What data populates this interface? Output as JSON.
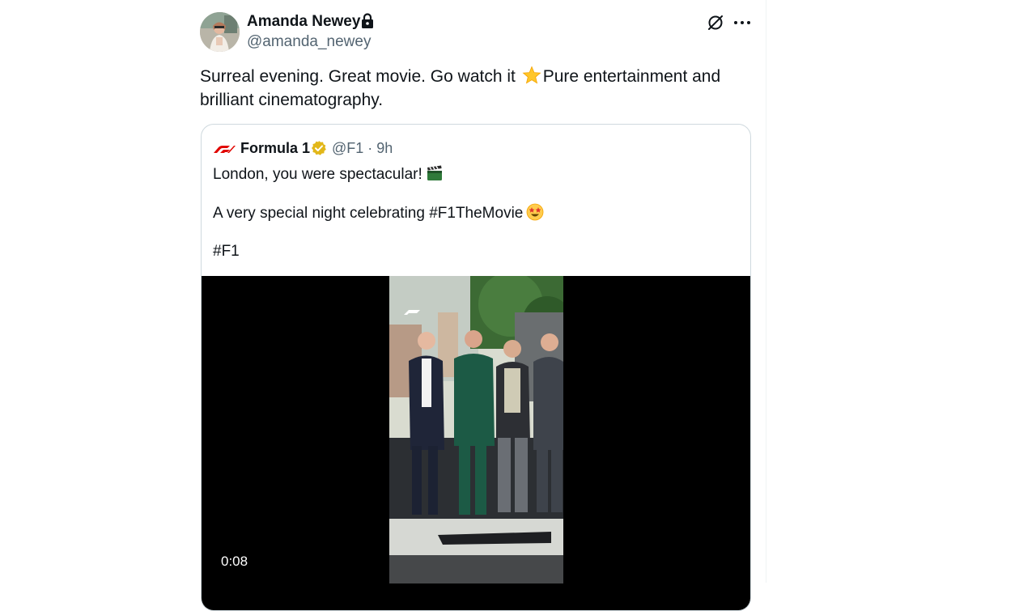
{
  "author": {
    "display_name": "Amanda Newey",
    "handle": "@amanda_newey",
    "avatar_icon": "profile-photo",
    "protected_icon": "lock-icon"
  },
  "tweet": {
    "text_before_emoji": "Surreal evening. Great movie. Go watch it ",
    "emoji": "star-emoji",
    "text_after_emoji": "Pure entertainment and\nbrilliant cinematography."
  },
  "actions": {
    "grok_icon": "grok-icon",
    "more_icon": "more-icon"
  },
  "quoted": {
    "logo": "f1-logo",
    "name": "Formula 1",
    "verified_icon": "verified-gold-badge",
    "handle_time": "@F1 · 9h",
    "line1": "London, you were spectacular!",
    "line1_emoji": "clapper-board-emoji",
    "line2": "A very special night celebrating #F1TheMovie",
    "line2_emoji": "star-struck-emoji",
    "line3": "#F1",
    "video": {
      "timestamp": "0:08"
    }
  },
  "colors": {
    "text_primary": "#0f1419",
    "text_secondary": "#536471",
    "border": "#cfd9de",
    "f1_red": "#e10600",
    "verified_gold": "#e2b719"
  }
}
